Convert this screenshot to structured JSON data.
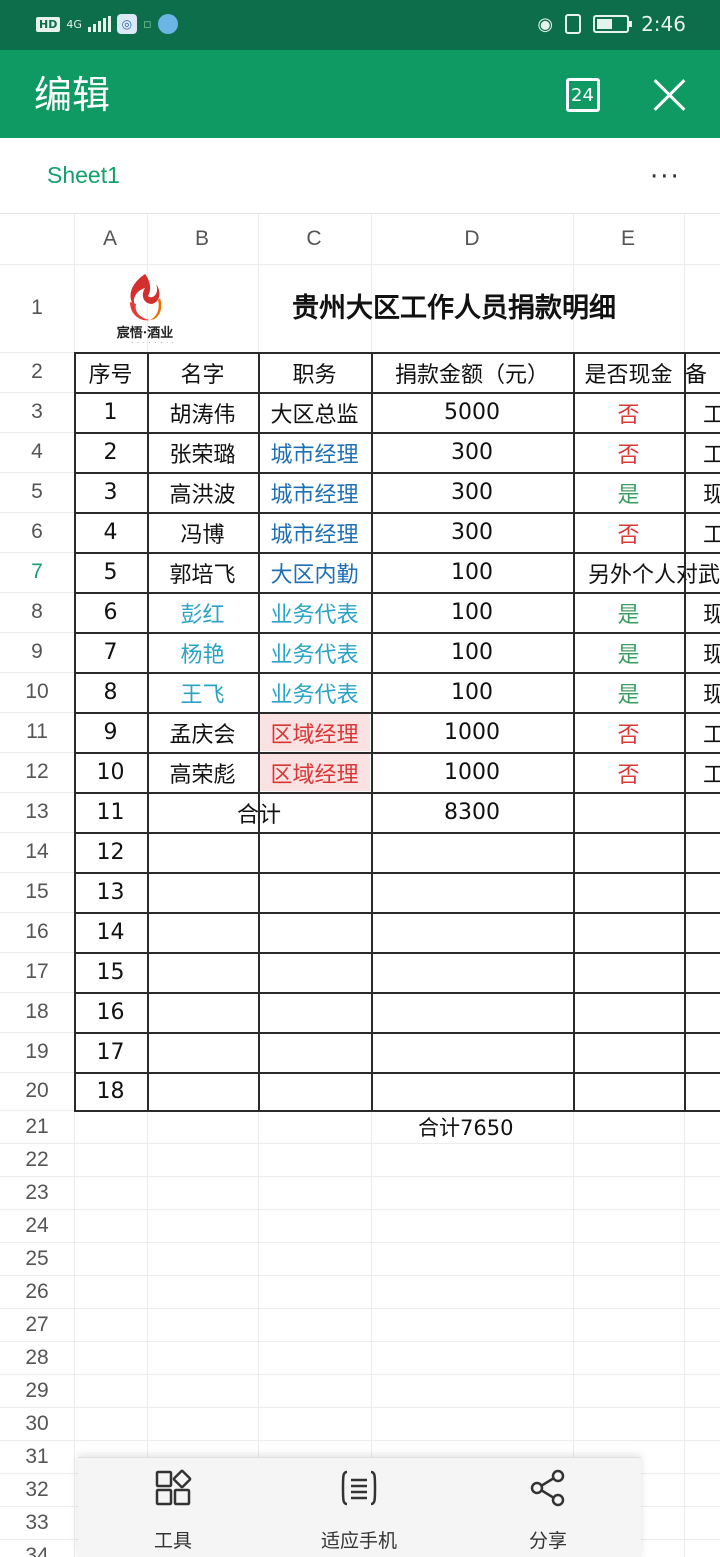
{
  "status_bar": {
    "left_chip": "HD",
    "signal_label": "4G",
    "time": "2:46"
  },
  "app_bar": {
    "title": "编辑",
    "calendar_badge": "24"
  },
  "tabs": {
    "sheet_name": "Sheet1",
    "more": "···"
  },
  "sheet": {
    "columns": [
      "A",
      "B",
      "C",
      "D",
      "E"
    ],
    "rows": [
      "1",
      "2",
      "3",
      "4",
      "5",
      "6",
      "7",
      "8",
      "9",
      "10",
      "11",
      "12",
      "13",
      "14",
      "15",
      "16",
      "17",
      "18",
      "19",
      "20",
      "21",
      "22",
      "23",
      "24",
      "25",
      "26",
      "27",
      "28",
      "29",
      "30",
      "31",
      "32",
      "33",
      "34"
    ],
    "active_row": "7",
    "title": "贵州大区工作人员捐款明细",
    "logo_text": "宸悟·酒业",
    "headers": [
      "序号",
      "名字",
      "职务",
      "捐款金额（元）",
      "是否现金",
      "备"
    ],
    "data_rows": [
      {
        "no": "1",
        "name": "胡涛伟",
        "title": "大区总监",
        "amount": "5000",
        "cash": "否",
        "extra": "工"
      },
      {
        "no": "2",
        "name": "张荣璐",
        "title": "城市经理",
        "amount": "300",
        "cash": "否",
        "extra": "工"
      },
      {
        "no": "3",
        "name": "高洪波",
        "title": "城市经理",
        "amount": "300",
        "cash": "是",
        "extra": "现"
      },
      {
        "no": "4",
        "name": "冯博",
        "title": "城市经理",
        "amount": "300",
        "cash": "否",
        "extra": "工"
      },
      {
        "no": "5",
        "name": "郭培飞",
        "title": "大区内勤",
        "amount": "100",
        "cash": "另外个人对武",
        "extra": ""
      },
      {
        "no": "6",
        "name": "彭红",
        "title": "业务代表",
        "amount": "100",
        "cash": "是",
        "extra": "现"
      },
      {
        "no": "7",
        "name": "杨艳",
        "title": "业务代表",
        "amount": "100",
        "cash": "是",
        "extra": "现"
      },
      {
        "no": "8",
        "name": "王飞",
        "title": "业务代表",
        "amount": "100",
        "cash": "是",
        "extra": "现"
      },
      {
        "no": "9",
        "name": "孟庆会",
        "title": "区域经理",
        "amount": "1000",
        "cash": "否",
        "extra": "工"
      },
      {
        "no": "10",
        "name": "高荣彪",
        "title": "区域经理",
        "amount": "1000",
        "cash": "否",
        "extra": "工"
      }
    ],
    "total_row": {
      "no": "11",
      "label": "合计",
      "amount": "8300"
    },
    "empty_rows": [
      "12",
      "13",
      "14",
      "15",
      "16",
      "17",
      "18"
    ],
    "note": "合计7650"
  },
  "toolbar": {
    "tools_label": "工具",
    "fit_label": "适应手机",
    "share_label": "分享"
  },
  "colors": {
    "status_bar": "#0c6e4a",
    "app_bar": "#0f9a63",
    "accent": "#14a06a"
  }
}
